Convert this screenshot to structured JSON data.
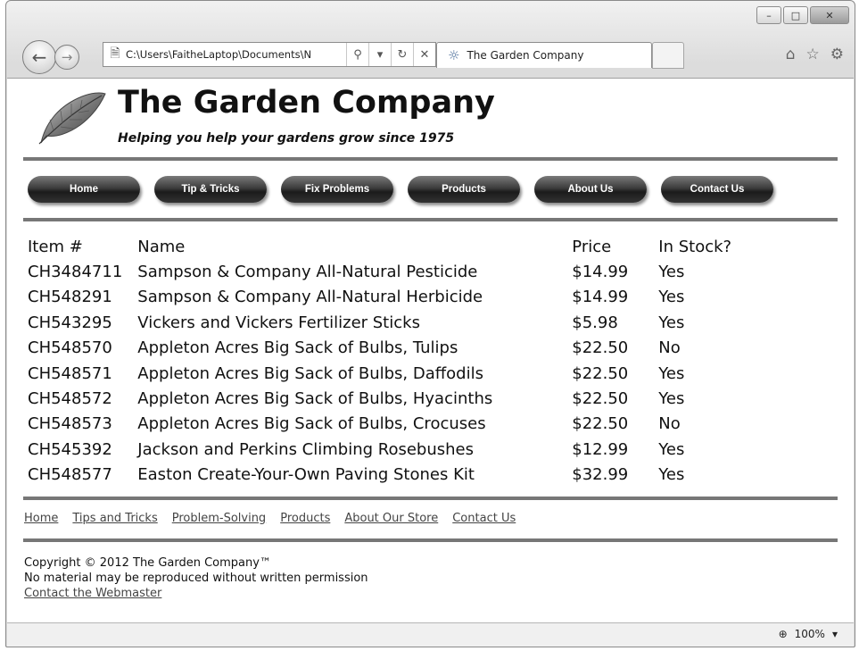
{
  "window": {
    "controls": {
      "minimize": "–",
      "maximize": "□",
      "close": "✕"
    }
  },
  "browser": {
    "address": "C:\\Users\\FaitheLaptop\\Documents\\N",
    "tab_title": "The Garden Company",
    "icons": [
      "back-arrow-icon",
      "forward-arrow-icon",
      "page-icon",
      "search-icon",
      "dropdown-icon",
      "refresh-icon",
      "stop-icon",
      "ie-logo-icon",
      "home-icon",
      "favorites-star-icon",
      "settings-gear-icon"
    ]
  },
  "site": {
    "title": "The Garden Company",
    "tagline": "Helping you help your gardens grow since 1975"
  },
  "menu": [
    "Home",
    "Tip & Tricks",
    "Fix Problems",
    "Products",
    "About Us",
    "Contact Us"
  ],
  "table": {
    "headers": [
      "Item #",
      "Name",
      "Price",
      "In Stock?"
    ],
    "rows": [
      [
        "CH3484711",
        "Sampson & Company All-Natural Pesticide",
        "$14.99",
        "Yes"
      ],
      [
        "CH548291",
        "Sampson & Company All-Natural Herbicide",
        "$14.99",
        "Yes"
      ],
      [
        "CH543295",
        "Vickers and Vickers Fertilizer Sticks",
        "$5.98",
        "Yes"
      ],
      [
        "CH548570",
        "Appleton Acres Big Sack of Bulbs, Tulips",
        "$22.50",
        "No"
      ],
      [
        "CH548571",
        "Appleton Acres Big Sack of Bulbs, Daffodils",
        "$22.50",
        "Yes"
      ],
      [
        "CH548572",
        "Appleton Acres Big Sack of Bulbs, Hyacinths",
        "$22.50",
        "Yes"
      ],
      [
        "CH548573",
        "Appleton Acres Big Sack of Bulbs, Crocuses",
        "$22.50",
        "No"
      ],
      [
        "CH545392",
        "Jackson and Perkins Climbing Rosebushes",
        "$12.99",
        "Yes"
      ],
      [
        "CH548577",
        "Easton Create-Your-Own Paving Stones Kit",
        "$32.99",
        "Yes"
      ]
    ]
  },
  "footer": {
    "links": [
      "Home",
      "Tips and Tricks",
      "Problem-Solving",
      "Products",
      "About Our Store",
      "Contact Us"
    ],
    "copyright_line1": "Copyright © 2012 The Garden Company™",
    "copyright_line2": "No material may be reproduced without written permission",
    "webmaster_link": "Contact the Webmaster"
  },
  "status": {
    "zoom": "100%"
  }
}
